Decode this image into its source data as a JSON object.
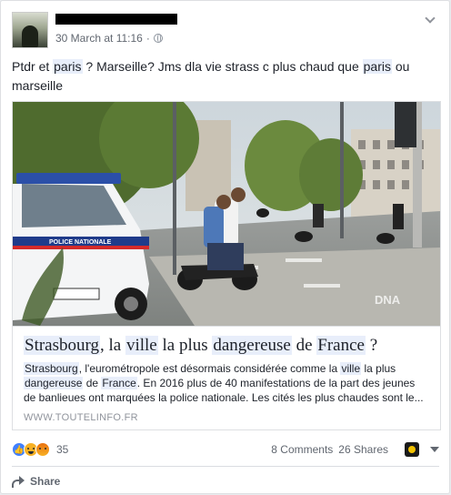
{
  "post": {
    "timestamp": "30 March at 11:16",
    "separator": "·",
    "text_parts": [
      {
        "t": "Ptdr et ",
        "hl": false
      },
      {
        "t": "paris",
        "hl": true
      },
      {
        "t": " ? Marseille? Jms dla vie strass c plus chaud que ",
        "hl": false
      },
      {
        "t": "paris",
        "hl": true
      },
      {
        "t": " ou marseille",
        "hl": false
      }
    ]
  },
  "link": {
    "image_watermark": "DNA",
    "title_parts": [
      {
        "t": "Strasbourg",
        "hl": true
      },
      {
        "t": ", la ",
        "hl": false
      },
      {
        "t": "ville",
        "hl": true
      },
      {
        "t": " la plus ",
        "hl": false
      },
      {
        "t": "dangereuse",
        "hl": true
      },
      {
        "t": " de ",
        "hl": false
      },
      {
        "t": "France",
        "hl": true
      },
      {
        "t": " ?",
        "hl": false
      }
    ],
    "desc_parts": [
      {
        "t": "Strasbourg",
        "hl": true
      },
      {
        "t": ", l'eurométropole est désormais considérée comme la ",
        "hl": false
      },
      {
        "t": "ville",
        "hl": true
      },
      {
        "t": " la plus ",
        "hl": false
      },
      {
        "t": "dangereuse",
        "hl": true
      },
      {
        "t": " de ",
        "hl": false
      },
      {
        "t": "France",
        "hl": true
      },
      {
        "t": ". En 2016 plus de 40 manifestations de la part des jeunes de banlieues ont marquées la police nationale. Les cités les plus chaudes sont le...",
        "hl": false
      }
    ],
    "domain": "WWW.TOUTELINFO.FR"
  },
  "engagement": {
    "reaction_count": "35",
    "reactions": [
      "like-icon",
      "haha-icon",
      "angry-icon"
    ],
    "comments": "8 Comments",
    "shares": "26 Shares"
  },
  "actions": {
    "share_label": "Share"
  },
  "colors": {
    "highlight": "#e8eefa",
    "like": "#4080ff",
    "haha": "#f7b125",
    "muted_text": "#616770"
  }
}
